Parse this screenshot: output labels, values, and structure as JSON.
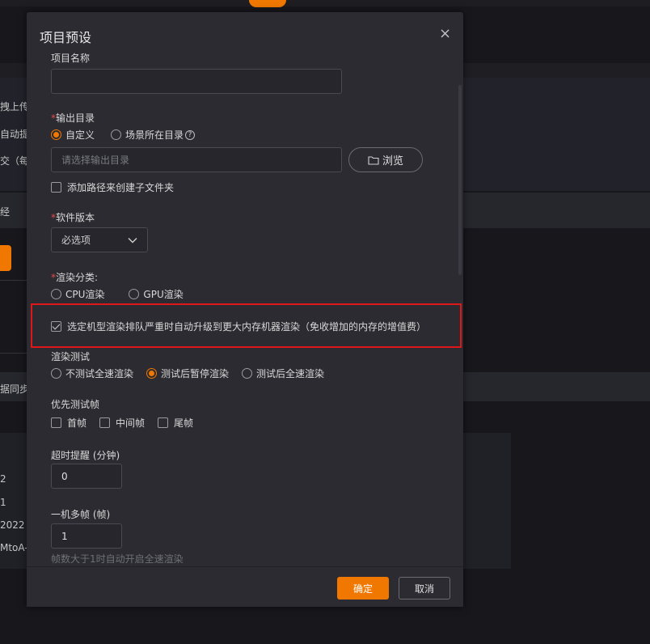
{
  "background": {
    "left_texts": [
      "拽上传",
      "自动提",
      "交（每",
      "经",
      "据同步",
      "2",
      "1",
      "2022",
      "MtoA-"
    ]
  },
  "modal": {
    "title": "项目预设",
    "project_name": {
      "label": "项目名称",
      "value": ""
    },
    "output_dir": {
      "label": "输出目录",
      "options": [
        "自定义",
        "场景所在目录"
      ],
      "selected": "自定义",
      "placeholder": "请选择输出目录",
      "browse_label": "浏览",
      "subfolder_label": "添加路径来创建子文件夹",
      "subfolder_checked": false
    },
    "software_version": {
      "label": "软件版本",
      "value": "必选项"
    },
    "render_category": {
      "label": "渲染分类:",
      "options": [
        "CPU渲染",
        "GPU渲染"
      ]
    },
    "auto_upgrade": {
      "label": "选定机型渲染排队严重时自动升级到更大内存机器渲染（免收增加的内存的增值费）",
      "checked": true
    },
    "render_test": {
      "label": "渲染测试",
      "options": [
        "不测试全速渲染",
        "测试后暂停渲染",
        "测试后全速渲染"
      ],
      "selected": "测试后暂停渲染"
    },
    "priority_frames": {
      "label": "优先测试帧",
      "options": [
        "首帧",
        "中间帧",
        "尾帧"
      ]
    },
    "timeout": {
      "label": "超时提醒 (分钟)",
      "value": "0"
    },
    "multi_frame": {
      "label": "一机多帧 (帧)",
      "value": "1",
      "hint": "帧数大于1时自动开启全速渲染"
    },
    "confirm_label": "确定",
    "cancel_label": "取消"
  }
}
